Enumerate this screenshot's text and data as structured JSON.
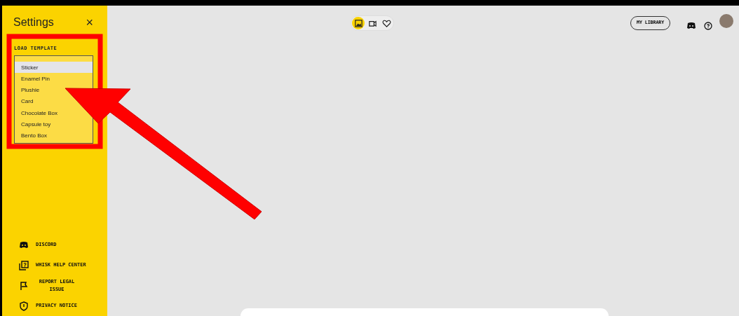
{
  "sidebar": {
    "title": "Settings",
    "close": "×",
    "section_label": "LOAD TEMPLATE",
    "templates": [
      {
        "label": "Sticker",
        "selected": true
      },
      {
        "label": "Enamel Pin",
        "selected": false
      },
      {
        "label": "Plushie",
        "selected": false
      },
      {
        "label": "Card",
        "selected": false
      },
      {
        "label": "Chocolate Box",
        "selected": false
      },
      {
        "label": "Capsule toy",
        "selected": false
      },
      {
        "label": "Bento Box",
        "selected": false
      }
    ],
    "links": [
      {
        "kind": "discord",
        "label": "DISCORD"
      },
      {
        "kind": "help",
        "label": "WHISK HELP CENTER"
      },
      {
        "kind": "flag",
        "label": "REPORT LEGAL ISSUE"
      },
      {
        "kind": "privacy",
        "label": "PRIVACY NOTICE"
      }
    ]
  },
  "mode_toggle": [
    {
      "kind": "image",
      "selected": true
    },
    {
      "kind": "video",
      "selected": false
    },
    {
      "kind": "heart",
      "selected": false
    }
  ],
  "header": {
    "library_button": "MY LIBRARY"
  }
}
